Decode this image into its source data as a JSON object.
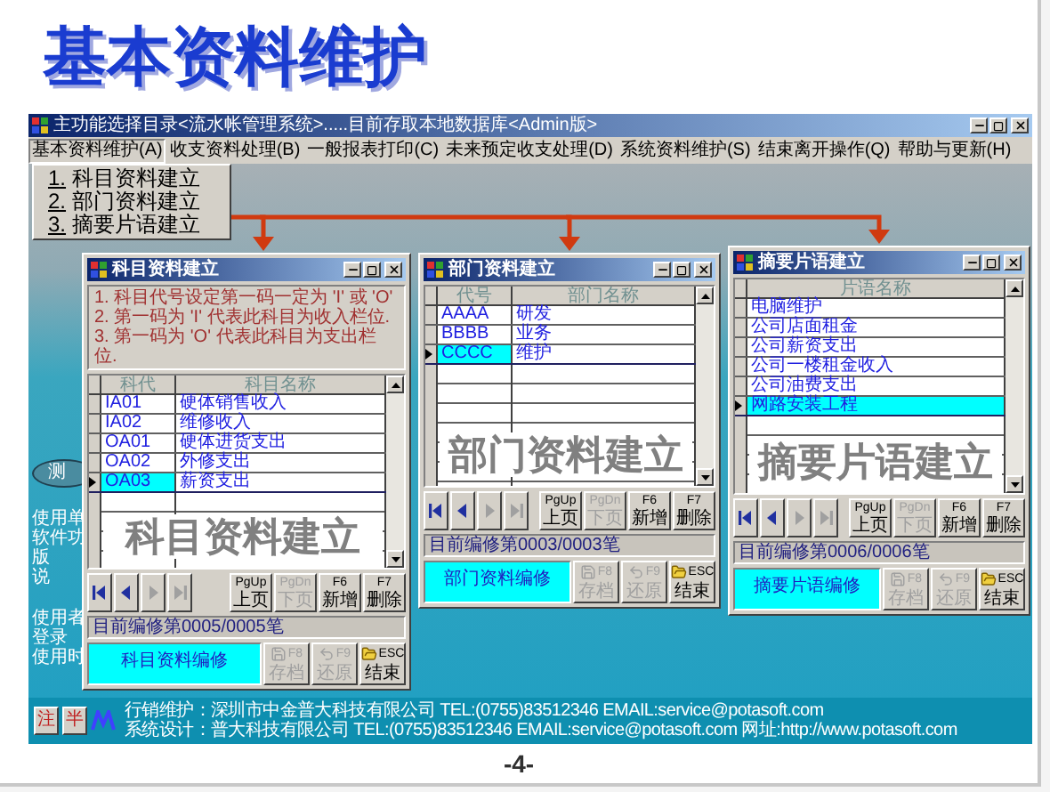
{
  "slide_title": "基本资料维护",
  "app": {
    "title": "主功能选择目录<流水帐管理系统>.....目前存取本地数据库<Admin版>",
    "menu": [
      {
        "label": "基本资料维护(A)",
        "selected": true
      },
      {
        "label": "收支资料处理(B)",
        "selected": false
      },
      {
        "label": "一般报表打印(C)",
        "selected": false
      },
      {
        "label": "未来预定收支处理(D)",
        "selected": false
      },
      {
        "label": "系统资料维护(S)",
        "selected": false
      },
      {
        "label": "结束离开操作(Q)",
        "selected": false
      },
      {
        "label": "帮助与更新(H)",
        "selected": false
      }
    ],
    "dropdown": [
      {
        "key": "1.",
        "label": "科目资料建立"
      },
      {
        "key": "2.",
        "label": "部门资料建立"
      },
      {
        "key": "3.",
        "label": "摘要片语建立"
      }
    ],
    "side_button": "测",
    "side_texts": [
      "使用单",
      "软件功",
      "版",
      "说",
      "使用者",
      "登录",
      "使用时"
    ],
    "footer_buttons": [
      "注",
      "半"
    ],
    "footer_lines": [
      "行销维护：深圳市中金普大科技有限公司 TEL:(0755)83512346 EMAIL:service@potasoft.com",
      "系统设计：普大科技有限公司 TEL:(0755)83512346 EMAIL:service@potasoft.com 网址:http://www.potasoft.com"
    ]
  },
  "windows": [
    {
      "title": "科目资料建立",
      "notes": [
        "1. 科目代号设定第一码一定为 'I' 或 'O'",
        "2. 第一码为 'I' 代表此科目为收入栏位.",
        "3. 第一码为 'O' 代表此科目为支出栏位."
      ],
      "columns": [
        "科代",
        "科目名称"
      ],
      "rows": [
        {
          "cells": [
            "IA01",
            "硬体销售收入"
          ],
          "selected": false
        },
        {
          "cells": [
            "IA02",
            "维修收入"
          ],
          "selected": false
        },
        {
          "cells": [
            "OA01",
            "硬体进货支出"
          ],
          "selected": false
        },
        {
          "cells": [
            "OA02",
            "外修支出"
          ],
          "selected": false
        },
        {
          "cells": [
            "OA03",
            "薪资支出"
          ],
          "selected": true
        }
      ],
      "watermark": "科目资料建立",
      "nav_buttons": [
        {
          "kind": "first",
          "disabled": false
        },
        {
          "kind": "prev",
          "disabled": false
        },
        {
          "kind": "next",
          "disabled": true
        },
        {
          "kind": "last",
          "disabled": true
        }
      ],
      "page_buttons": [
        {
          "key": "PgUp",
          "label": "上页",
          "disabled": false
        },
        {
          "key": "PgDn",
          "label": "下页",
          "disabled": true
        },
        {
          "key": "F6",
          "label": "新增",
          "disabled": false
        },
        {
          "key": "F7",
          "label": "删除",
          "disabled": false
        }
      ],
      "action_buttons": [
        {
          "kind": "save",
          "key": "F8",
          "label": "存档",
          "disabled": true
        },
        {
          "kind": "undo",
          "key": "F9",
          "label": "还原",
          "disabled": true
        },
        {
          "kind": "exit",
          "key": "ESC",
          "label": "结束",
          "disabled": false
        }
      ],
      "status": "目前编修第0005/0005笔",
      "mode": "科目资料编修"
    },
    {
      "title": "部门资料建立",
      "columns": [
        "代号",
        "部门名称"
      ],
      "rows": [
        {
          "cells": [
            "AAAA",
            "研发"
          ],
          "selected": false
        },
        {
          "cells": [
            "BBBB",
            "业务"
          ],
          "selected": false
        },
        {
          "cells": [
            "CCCC",
            "维护"
          ],
          "selected": true
        }
      ],
      "watermark": "部门资料建立",
      "nav_buttons": [
        {
          "kind": "first",
          "disabled": false
        },
        {
          "kind": "prev",
          "disabled": false
        },
        {
          "kind": "next",
          "disabled": true
        },
        {
          "kind": "last",
          "disabled": true
        }
      ],
      "page_buttons": [
        {
          "key": "PgUp",
          "label": "上页",
          "disabled": false
        },
        {
          "key": "PgDn",
          "label": "下页",
          "disabled": true
        },
        {
          "key": "F6",
          "label": "新增",
          "disabled": false
        },
        {
          "key": "F7",
          "label": "删除",
          "disabled": false
        }
      ],
      "action_buttons": [
        {
          "kind": "save",
          "key": "F8",
          "label": "存档",
          "disabled": true
        },
        {
          "kind": "undo",
          "key": "F9",
          "label": "还原",
          "disabled": true
        },
        {
          "kind": "exit",
          "key": "ESC",
          "label": "结束",
          "disabled": false
        }
      ],
      "status": "目前编修第0003/0003笔",
      "mode": "部门资料编修"
    },
    {
      "title": "摘要片语建立",
      "columns": [
        "片语名称"
      ],
      "rows": [
        {
          "cells": [
            "电脑维护"
          ],
          "selected": false
        },
        {
          "cells": [
            "公司店面租金"
          ],
          "selected": false
        },
        {
          "cells": [
            "公司薪资支出"
          ],
          "selected": false
        },
        {
          "cells": [
            "公司一楼租金收入"
          ],
          "selected": false
        },
        {
          "cells": [
            "公司油费支出"
          ],
          "selected": false
        },
        {
          "cells": [
            "网路安装工程"
          ],
          "selected": true
        }
      ],
      "watermark": "摘要片语建立",
      "nav_buttons": [
        {
          "kind": "first",
          "disabled": false
        },
        {
          "kind": "prev",
          "disabled": false
        },
        {
          "kind": "next",
          "disabled": true
        },
        {
          "kind": "last",
          "disabled": true
        }
      ],
      "page_buttons": [
        {
          "key": "PgUp",
          "label": "上页",
          "disabled": false
        },
        {
          "key": "PgDn",
          "label": "下页",
          "disabled": true
        },
        {
          "key": "F6",
          "label": "新增",
          "disabled": false
        },
        {
          "key": "F7",
          "label": "删除",
          "disabled": false
        }
      ],
      "action_buttons": [
        {
          "kind": "save",
          "key": "F8",
          "label": "存档",
          "disabled": true
        },
        {
          "kind": "undo",
          "key": "F9",
          "label": "还原",
          "disabled": true
        },
        {
          "kind": "exit",
          "key": "ESC",
          "label": "结束",
          "disabled": false
        }
      ],
      "status": "目前编修第0006/0006笔",
      "mode": "摘要片语编修"
    }
  ],
  "page_number": "-4-"
}
